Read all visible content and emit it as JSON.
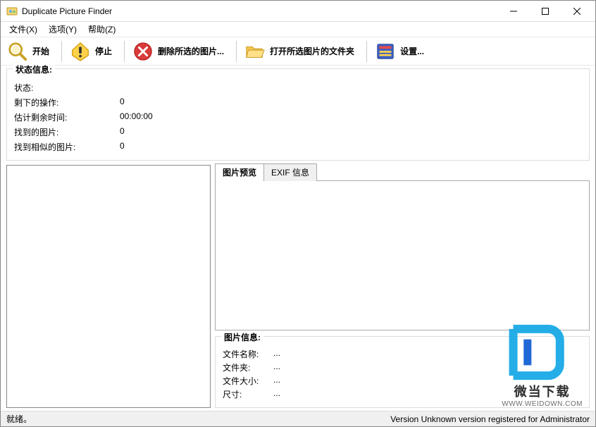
{
  "window": {
    "title": "Duplicate Picture Finder"
  },
  "menu": {
    "file": "文件(X)",
    "options": "选项(Y)",
    "help": "帮助(Z)"
  },
  "toolbar": {
    "start": "开始",
    "stop": "停止",
    "delete_selected": "删除所选的图片...",
    "open_folder": "打开所选图片的文件夹",
    "settings": "设置..."
  },
  "status_group": {
    "title": "状态信息:",
    "state_label": "状态:",
    "state_value": "",
    "remaining_ops_label": "剩下的操作:",
    "remaining_ops_value": "0",
    "est_time_label": "估计剩余时间:",
    "est_time_value": "00:00:00",
    "found_pics_label": "找到的图片:",
    "found_pics_value": "0",
    "found_similar_label": "找到相似的图片:",
    "found_similar_value": "0"
  },
  "tabs": {
    "preview": "图片预览",
    "exif": "EXIF 信息"
  },
  "pic_info": {
    "title": "图片信息:",
    "filename_label": "文件名称:",
    "filename_value": "...",
    "folder_label": "文件夹:",
    "folder_value": "...",
    "filesize_label": "文件大小:",
    "filesize_value": "...",
    "dims_label": "尺寸:",
    "dims_value": "..."
  },
  "statusbar": {
    "left": "就绪。",
    "right": "Version Unknown version registered for Administrator"
  },
  "watermark": {
    "line1": "微当下载",
    "line2": "WWW.WEIDOWN.COM"
  }
}
